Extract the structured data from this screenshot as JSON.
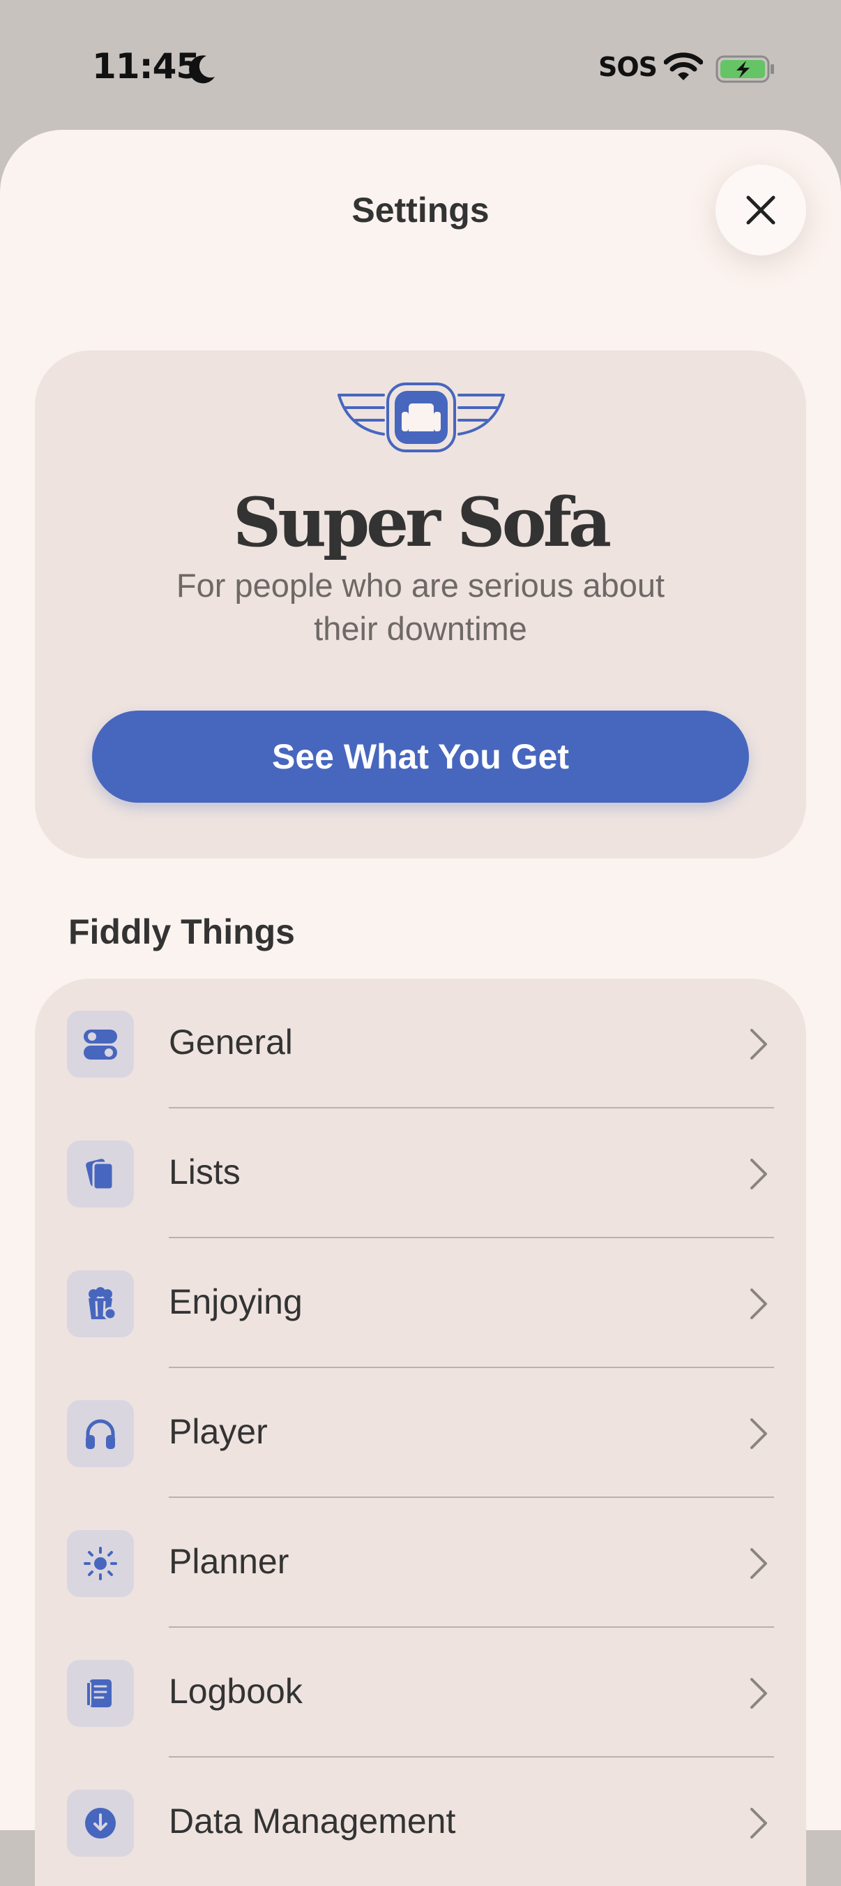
{
  "status_bar": {
    "time": "11:45",
    "carrier": "SOS"
  },
  "sheet": {
    "title": "Settings"
  },
  "promo": {
    "name": "Super Sofa",
    "tagline": "For people who are serious about their downtime",
    "button_label": "See What You Get"
  },
  "section": {
    "title": "Fiddly Things"
  },
  "rows": [
    {
      "label": "General",
      "icon": "toggles-icon"
    },
    {
      "label": "Lists",
      "icon": "cards-icon"
    },
    {
      "label": "Enjoying",
      "icon": "popcorn-icon"
    },
    {
      "label": "Player",
      "icon": "headphones-icon"
    },
    {
      "label": "Planner",
      "icon": "sun-icon"
    },
    {
      "label": "Logbook",
      "icon": "notebook-icon"
    },
    {
      "label": "Data Management",
      "icon": "download-icon"
    }
  ],
  "colors": {
    "accent": "#4766be",
    "sheet_background": "#fbf3ef",
    "card_background": "#eee3df",
    "icon_tile": "#d9d6e0",
    "battery_fill": "#65c466"
  }
}
